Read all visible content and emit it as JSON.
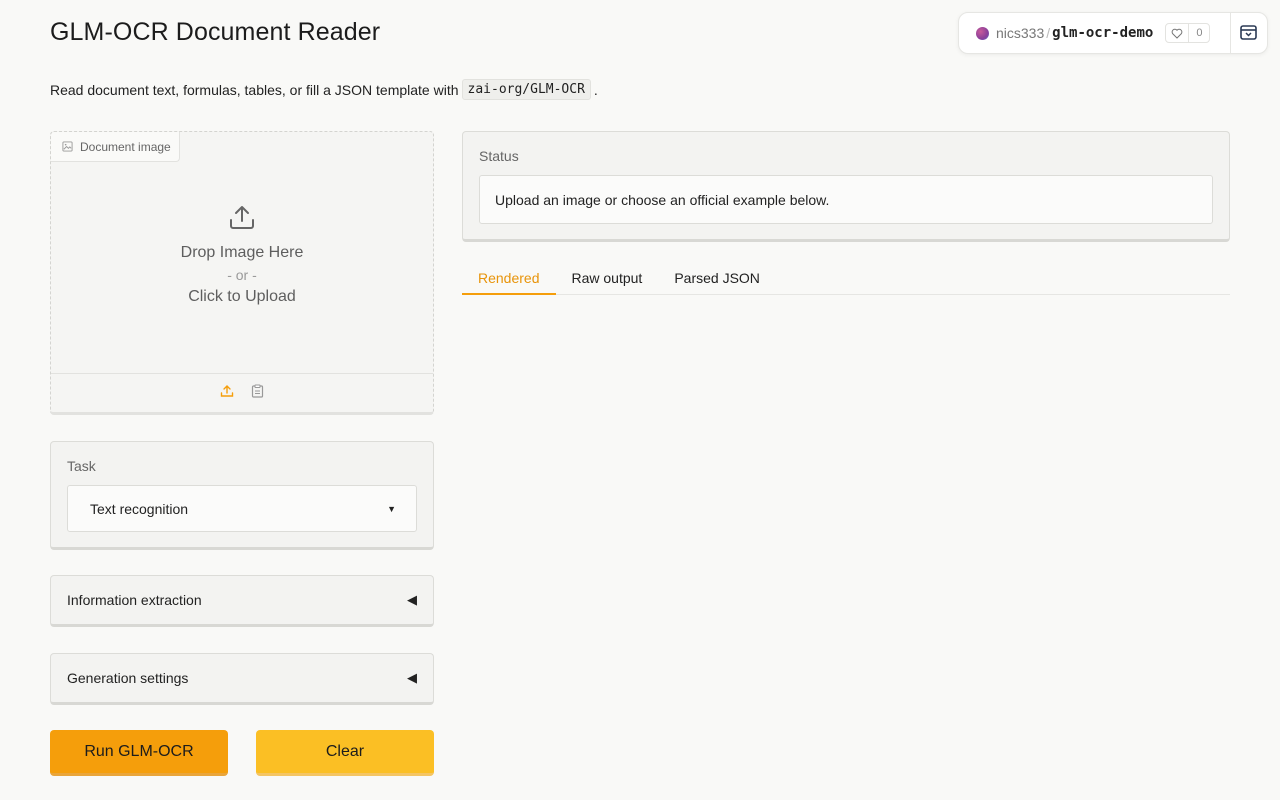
{
  "header": {
    "title": "GLM-OCR Document Reader",
    "subtitle_before": "Read document text, formulas, tables, or fill a JSON template with",
    "subtitle_code": "zai-org/GLM-OCR",
    "subtitle_after": "."
  },
  "space": {
    "owner": "nics333",
    "separator": "/",
    "name": "glm-ocr-demo",
    "likes": "0"
  },
  "upload": {
    "label": "Document image",
    "drop_text": "Drop Image Here",
    "or_text": "- or -",
    "click_text": "Click to Upload"
  },
  "task": {
    "label": "Task",
    "selected": "Text recognition"
  },
  "accordions": {
    "info_extraction": "Information extraction",
    "generation_settings": "Generation settings",
    "arrow": "◀"
  },
  "buttons": {
    "run": "Run GLM-OCR",
    "clear": "Clear"
  },
  "status": {
    "label": "Status",
    "message": "Upload an image or choose an official example below."
  },
  "tabs": [
    {
      "label": "Rendered",
      "active": true
    },
    {
      "label": "Raw output",
      "active": false
    },
    {
      "label": "Parsed JSON",
      "active": false
    }
  ],
  "colors": {
    "accent": "#f59e0b",
    "run_button": "#f59e0b",
    "clear_button": "#fbbf24",
    "active_tab": "#e8940a"
  }
}
